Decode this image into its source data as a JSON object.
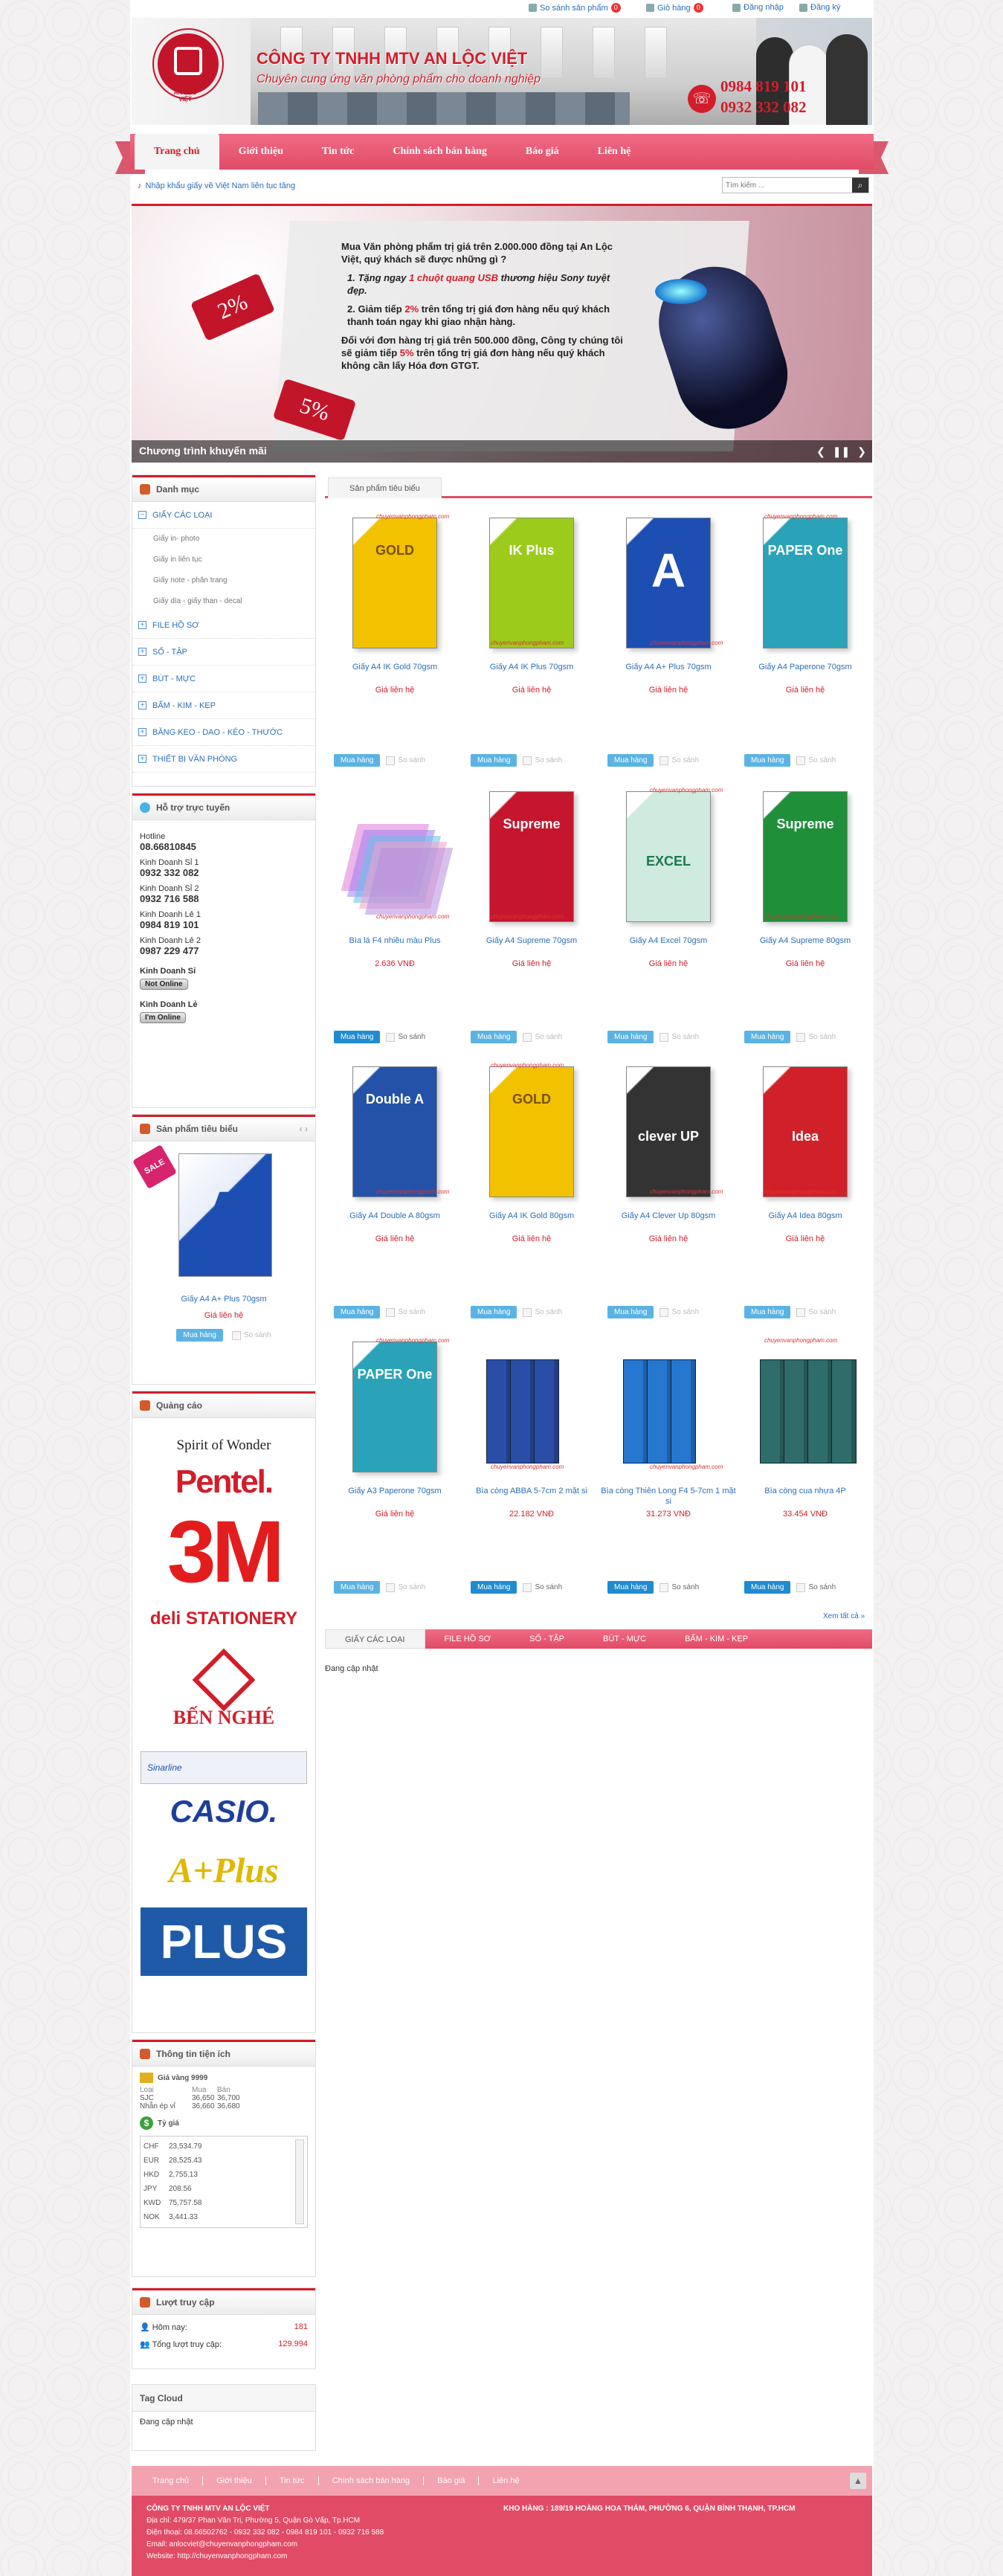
{
  "topbar": {
    "compare": "So sánh sản phẩm",
    "compare_count": "0",
    "cart": "Giỏ hàng",
    "cart_count": "0",
    "login": "Đăng nhập",
    "register": "Đăng ký"
  },
  "header": {
    "company": "CÔNG TY TNHH MTV AN LỘC VIỆT",
    "slogan": "Chuyên cung ứng văn phòng phẩm cho doanh nghiệp",
    "logo_text": "AN LỘC VIỆT",
    "phone1": "0984 819 101",
    "phone2": "0932 332 082"
  },
  "nav": [
    "Trang chủ",
    "Giới thiệu",
    "Tin tức",
    "Chính sách bán hàng",
    "Báo giá",
    "Liên hệ"
  ],
  "marquee": "Nhập khẩu giấy về Việt Nam liên tục tăng",
  "search": {
    "placeholder": "Tìm kiếm ..."
  },
  "slider": {
    "p1": "Mua Văn phòng phẩm trị giá trên 2.000.000 đồng tại An Lộc Việt, quý khách sẽ được những gì ?",
    "p2a": "1. Tặng ngay ",
    "p2b": "1 chuột quang USB",
    "p2c": " thương hiệu Sony tuyệt đẹp.",
    "p3a": "2. Giảm tiếp ",
    "p3b": "2%",
    "p3c": " trên tổng trị giá đơn hàng nếu quý khách thanh toán ngay khi giao nhận hàng.",
    "p4a": "Đối với đơn hàng trị giá trên 500.000 đồng, Công ty chúng tôi sẽ giảm tiếp ",
    "p4b": "5%",
    "p4c": " trên tổng trị giá đơn hàng nếu quý khách không cần lấy Hóa đơn GTGT.",
    "tag1": "2%",
    "tag2": "5%",
    "caption": "Chương trình khuyến mãi"
  },
  "sidebar": {
    "cat_title": "Danh mục",
    "cats": [
      {
        "label": "GIẤY CÁC LOẠI",
        "sub": [
          "Giấy in- photo",
          "Giấy in liên tục",
          "Giấy note - phân trang",
          "Giấy dìa - giấy than - decal"
        ]
      },
      {
        "label": "FILE HỒ SƠ"
      },
      {
        "label": "SỔ - TẬP"
      },
      {
        "label": "BÚT - MỰC"
      },
      {
        "label": "BẤM - KIM - KẸP"
      },
      {
        "label": "BĂNG KEO - DAO - KÉO - THƯỚC"
      },
      {
        "label": "THIẾT BỊ VĂN PHÒNG"
      }
    ],
    "support_title": "Hỗ trợ trực tuyến",
    "support": [
      {
        "name": "Hotline",
        "tel": "08.66810845"
      },
      {
        "name": "Kinh Doanh Sỉ 1",
        "tel": "0932 332 082"
      },
      {
        "name": "Kinh Doanh Sỉ 2",
        "tel": "0932 716 588"
      },
      {
        "name": "Kinh Doanh Lẻ 1",
        "tel": "0984 819 101"
      },
      {
        "name": "Kinh Doanh Lẻ 2",
        "tel": "0987 229 477"
      }
    ],
    "yahoo": [
      {
        "name": "Kinh Doanh Sỉ",
        "status": "Not Online"
      },
      {
        "name": "Kinh Doanh Lẻ",
        "status": "I'm Online"
      }
    ],
    "featured_title": "Sản phẩm tiêu biểu",
    "featured": {
      "name": "Giấy A4 A+ Plus 70gsm",
      "price": "Giá liên hệ",
      "buy": "Mua hàng",
      "compare": "So sánh",
      "sale": "SALE"
    },
    "ads_title": "Quảng cáo",
    "ads": [
      "Spirit of Wonder",
      "Pentel.",
      "3M",
      "deli STATIONERY",
      "BẾN NGHÉ",
      "Sinarline",
      "CASIO.",
      "A+Plus",
      "PLUS"
    ],
    "info_title": "Thông tin tiện ích",
    "gold_title": "Giá vàng 9999",
    "gold_head": [
      "Loại",
      "Mua",
      "Bán"
    ],
    "gold": [
      [
        "SJC",
        "36,650",
        "36,700"
      ],
      [
        "Nhẫn ép vỉ",
        "36,660",
        "36,680"
      ]
    ],
    "fx_title": "Tỷ giá",
    "fx": [
      [
        "CHF",
        "23,534.79"
      ],
      [
        "EUR",
        "28,525.43"
      ],
      [
        "HKD",
        "2,755.13"
      ],
      [
        "JPY",
        "208.56"
      ],
      [
        "KWD",
        "75,757.58"
      ],
      [
        "NOK",
        "3,441.33"
      ]
    ],
    "visit_title": "Lượt truy cập",
    "visit": [
      {
        "label": "Hôm nay:",
        "value": "181"
      },
      {
        "label": "Tổng lượt truy cập:",
        "value": "129.994"
      }
    ],
    "tag_title": "Tag Cloud",
    "tag_text": "Đang cập nhật"
  },
  "products": {
    "tab": "Sản phẩm tiêu biểu",
    "buy": "Mua hàng",
    "compare": "So sánh",
    "watermark": "chuyenvanphongpham.com",
    "items": [
      {
        "name": "Giấy A4 IK Gold 70gsm",
        "price": "Giá liên hệ",
        "brand": "GOLD",
        "color": "#f2c200"
      },
      {
        "name": "Giấy A4 IK Plus 70gsm",
        "price": "Giá liên hệ",
        "brand": "IK Plus",
        "color": "#9ccb1b"
      },
      {
        "name": "Giấy A4 A+ Plus 70gsm",
        "price": "Giá liên hệ",
        "brand": "A",
        "color": "#1d4fb3"
      },
      {
        "name": "Giấy A4 Paperone 70gsm",
        "price": "Giá liên hệ",
        "brand": "PAPER One",
        "color": "#2aa3b8"
      },
      {
        "name": "Bìa lá F4 nhiều màu Plus",
        "price": "2.636 VNĐ",
        "brand": "",
        "color": "#b58ee0"
      },
      {
        "name": "Giấy A4 Supreme 70gsm",
        "price": "Giá liên hệ",
        "brand": "Supreme",
        "color": "#c5162e"
      },
      {
        "name": "Giấy A4 Excel 70gsm",
        "price": "Giá liên hệ",
        "brand": "EXCEL",
        "color": "#cfeadf"
      },
      {
        "name": "Giấy A4 Supreme 80gsm",
        "price": "Giá liên hệ",
        "brand": "Supreme",
        "color": "#1f8f3a"
      },
      {
        "name": "Giấy A4 Double A 80gsm",
        "price": "Giá liên hệ",
        "brand": "Double A",
        "color": "#2452a8"
      },
      {
        "name": "Giấy A4 IK Gold 80gsm",
        "price": "Giá liên hệ",
        "brand": "GOLD",
        "color": "#f2c200"
      },
      {
        "name": "Giấy A4 Clever Up 80gsm",
        "price": "Giá liên hệ",
        "brand": "clever UP",
        "color": "#333"
      },
      {
        "name": "Giấy A4 Idea 80gsm",
        "price": "Giá liên hệ",
        "brand": "Idea",
        "color": "#d0202a"
      },
      {
        "name": "Giấy A3 Paperone 70gsm",
        "price": "Giá liên hệ",
        "brand": "PAPER One",
        "color": "#2aa3b8"
      },
      {
        "name": "Bìa còng ABBA 5-7cm 2 mặt si",
        "price": "22.182 VNĐ",
        "brand": "",
        "color": "#2a4ea8"
      },
      {
        "name": "Bìa còng Thiên Long F4 5-7cm 1 mặt si",
        "price": "31.273 VNĐ",
        "brand": "",
        "color": "#2677d0"
      },
      {
        "name": "Bìa còng cua nhựa 4P",
        "price": "33.454 VNĐ",
        "brand": "",
        "color": "#2f6d6a"
      }
    ],
    "see_all": "Xem tất cả »"
  },
  "cat_tabs": [
    "GIẤY CÁC LOẠI",
    "FILE HỒ SƠ",
    "SỔ - TẬP",
    "BÚT - MỰC",
    "BẤM - KIM - KẸP"
  ],
  "cat_tab_content": "Đang cập nhật",
  "footer": {
    "nav": [
      "Trang chủ",
      "Giới thiệu",
      "Tin tức",
      "Chính sách bán hàng",
      "Báo giá",
      "Liên hệ"
    ],
    "company": "CÔNG TY TNHH MTV AN LỘC VIỆT",
    "address": "Địa chỉ: 479/37 Phan Văn Trị, Phường 5, Quận Gò Vấp, Tp.HCM",
    "phone": "Điện thoại: 08.66502762 - 0932 332 082 - 0984 819 101 - 0932 716 588",
    "email": "Email: anlocviet@chuyenvanphongpham.com",
    "website": "Website: http://chuyenvanphongpham.com",
    "warehouse": "KHO HÀNG : 189/19 HOÀNG HOA THÁM, PHƯỜNG 6, QUẬN BÌNH THẠNH, TP.HCM"
  }
}
